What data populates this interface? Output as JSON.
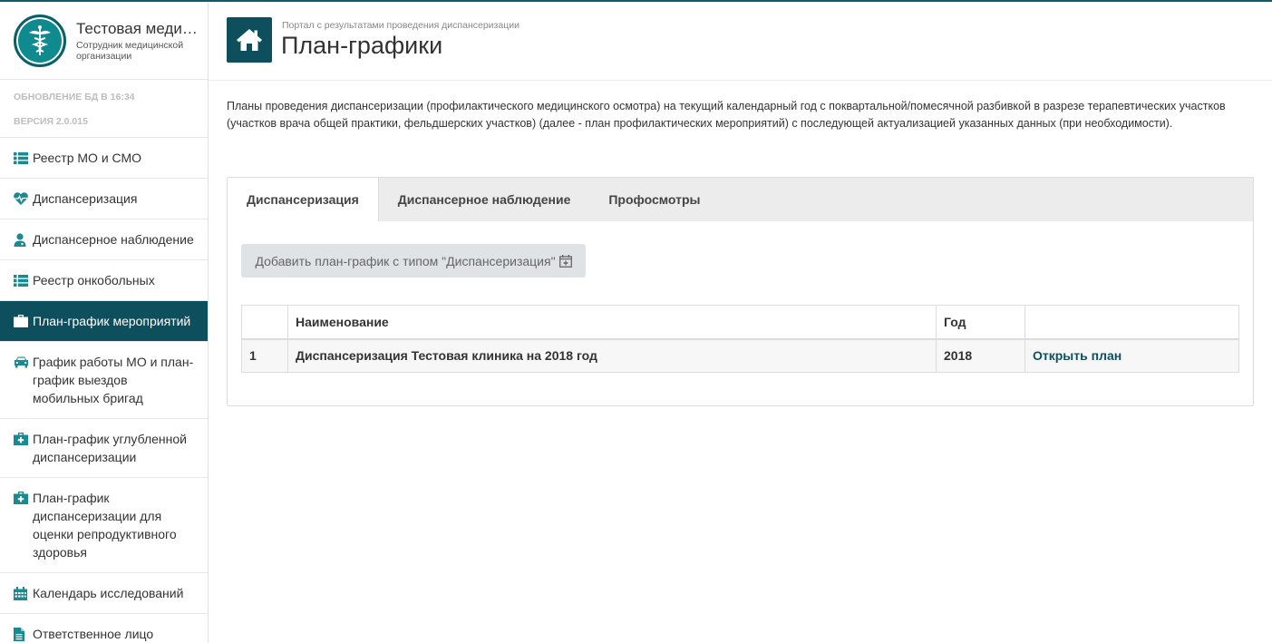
{
  "brand": {
    "title": "Тестовая медицинская организация",
    "subtitle": "Сотрудник медицинской организации"
  },
  "meta": {
    "db_update": "ОБНОВЛЕНИЕ БД В 16:34",
    "version": "ВЕРСИЯ 2.0.015"
  },
  "sidebar": {
    "items": [
      {
        "label": "Реестр МО и СМО",
        "icon": "list-icon"
      },
      {
        "label": "Диспансеризация",
        "icon": "heartbeat-icon"
      },
      {
        "label": "Диспансерное наблюдение",
        "icon": "user-doctor-icon"
      },
      {
        "label": "Реестр онкобольных",
        "icon": "list-icon"
      },
      {
        "label": "План-график мероприятий",
        "icon": "medkit-icon",
        "active": true
      },
      {
        "label": "График работы МО и план-график выездов мобильных бригад",
        "icon": "car-icon"
      },
      {
        "label": "План-график углубленной диспансеризации",
        "icon": "medkit-icon"
      },
      {
        "label": "План-график диспансеризации для оценки репродуктивного здоровья",
        "icon": "medkit-icon"
      },
      {
        "label": "Календарь исследований",
        "icon": "calendar-icon"
      },
      {
        "label": "Ответственное лицо",
        "icon": "file-icon"
      }
    ]
  },
  "header": {
    "subtitle": "Портал с результатами проведения диспансеризации",
    "title": "План-графики"
  },
  "intro": "Планы проведения диспансеризации (профилактического медицинского осмотра) на текущий календарный год с поквартальной/помесячной разбивкой в разрезе терапевтических участков (участков врача общей практики, фельдшерских участков) (далее - план профилактических мероприятий) с последующей актуализацией указанных данных (при необходимости).",
  "tabs": [
    {
      "label": "Диспансеризация",
      "active": true
    },
    {
      "label": "Диспансерное наблюдение"
    },
    {
      "label": "Профосмотры"
    }
  ],
  "add_button": "Добавить план-график с типом \"Диспансеризация\"",
  "table": {
    "headers": [
      "",
      "Наименование",
      "Год",
      ""
    ],
    "rows": [
      {
        "num": "1",
        "name": "Диспансеризация Тестовая клиника на 2018 год",
        "year": "2018",
        "action": "Открыть план"
      }
    ]
  },
  "colors": {
    "accent": "#0e4f5e",
    "icon": "#1a8a90"
  }
}
